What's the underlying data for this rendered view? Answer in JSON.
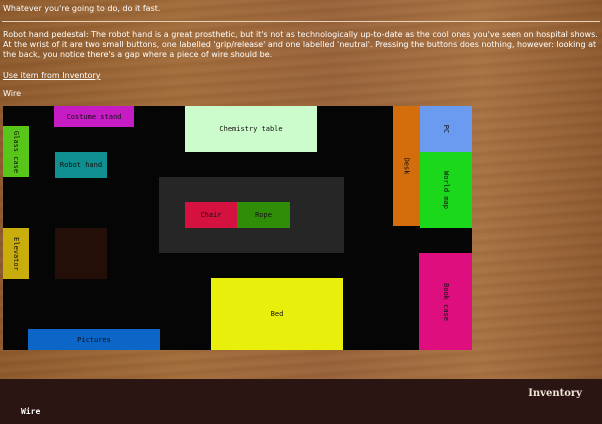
{
  "header": {
    "headline": "Whatever you're going to do, do it fast."
  },
  "description": "Robot hand pedestal: The robot hand is a great prosthetic, but it's not as technologically up-to-date as the cool ones you've seen on hospital shows. At the wrist of it are two small buttons, one labelled 'grip/release' and one labelled 'neutral'. Pressing the buttons does nothing, however: looking at the back, you notice there's a gap where a piece of wire should be.",
  "actions": {
    "use_item_link": "Use item from Inventory",
    "selected_item": "Wire"
  },
  "map": {
    "rooms": {
      "costume_stand": "Costume stand",
      "chemistry_table": "Chemistry table",
      "desk": "Desk",
      "pc": "PC",
      "glass_case": "Glass case",
      "robot_hand": "Robot hand",
      "world_map": "World map",
      "chair": "Chair",
      "rope": "Rope",
      "elevator": "Elevator",
      "dark_square": "",
      "book_case": "Book case",
      "bed": "Bed",
      "pictures": "Pictures"
    },
    "colors": {
      "background": "#050505",
      "center_area": "#262626",
      "costume_stand": "#c51cc3",
      "chemistry_table": "#ccfccb",
      "desk": "#d46d0c",
      "pc": "#6b9bf0",
      "glass_case": "#58c618",
      "robot_hand": "#0f8f8f",
      "world_map": "#1bd81b",
      "chair": "#d5123f",
      "rope": "#2f8d08",
      "elevator": "#c8ad0c",
      "dark_square": "#240e08",
      "book_case": "#df0e7e",
      "bed": "#e8ef0a",
      "pictures": "#0c66c7"
    }
  },
  "inventory": {
    "title": "Inventory",
    "items": [
      "Wire"
    ]
  }
}
